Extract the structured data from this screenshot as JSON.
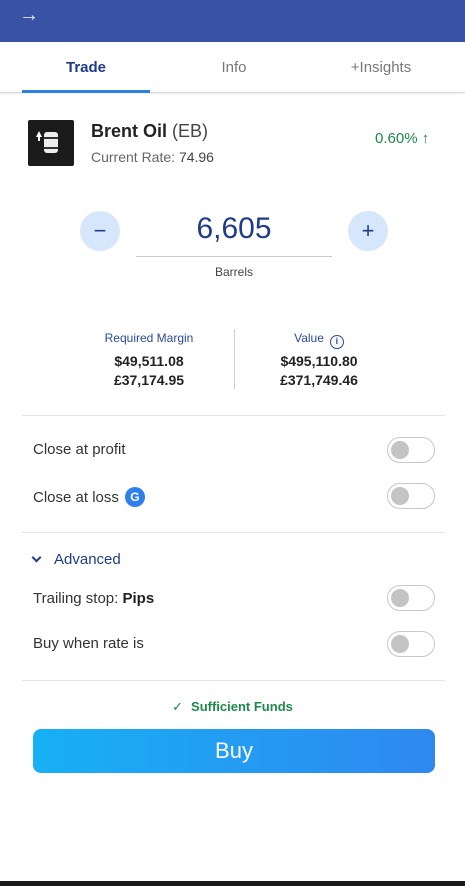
{
  "tabs": [
    {
      "label": "Trade"
    },
    {
      "label": "Info"
    },
    {
      "label": "+Insights"
    }
  ],
  "instrument": {
    "name": "Brent Oil",
    "code": "(EB)",
    "rate_label": "Current Rate:",
    "rate_value": "74.96",
    "change": "0.60% ↑"
  },
  "quantity": {
    "value": "6,605",
    "unit": "Barrels",
    "minus": "−",
    "plus": "+"
  },
  "margin": {
    "required_label": "Required Margin",
    "required_usd": "$49,511.08",
    "required_gbp": "£37,174.95",
    "value_label": "Value",
    "value_usd": "$495,110.80",
    "value_gbp": "£371,749.46"
  },
  "options": {
    "close_profit": "Close at profit",
    "close_loss": "Close at loss",
    "g_badge": "G",
    "advanced": "Advanced",
    "trailing_label": "Trailing stop:",
    "trailing_unit": "Pips",
    "buy_when": "Buy when rate is"
  },
  "funds": {
    "check": "✓",
    "text": "Sufficient Funds"
  },
  "buy_label": "Buy",
  "colors": {
    "header": "#3a52a3",
    "accent": "#1f3c8a",
    "positive": "#1d8a4b",
    "buy_start": "#17b0f5",
    "buy_end": "#2f88f0"
  }
}
